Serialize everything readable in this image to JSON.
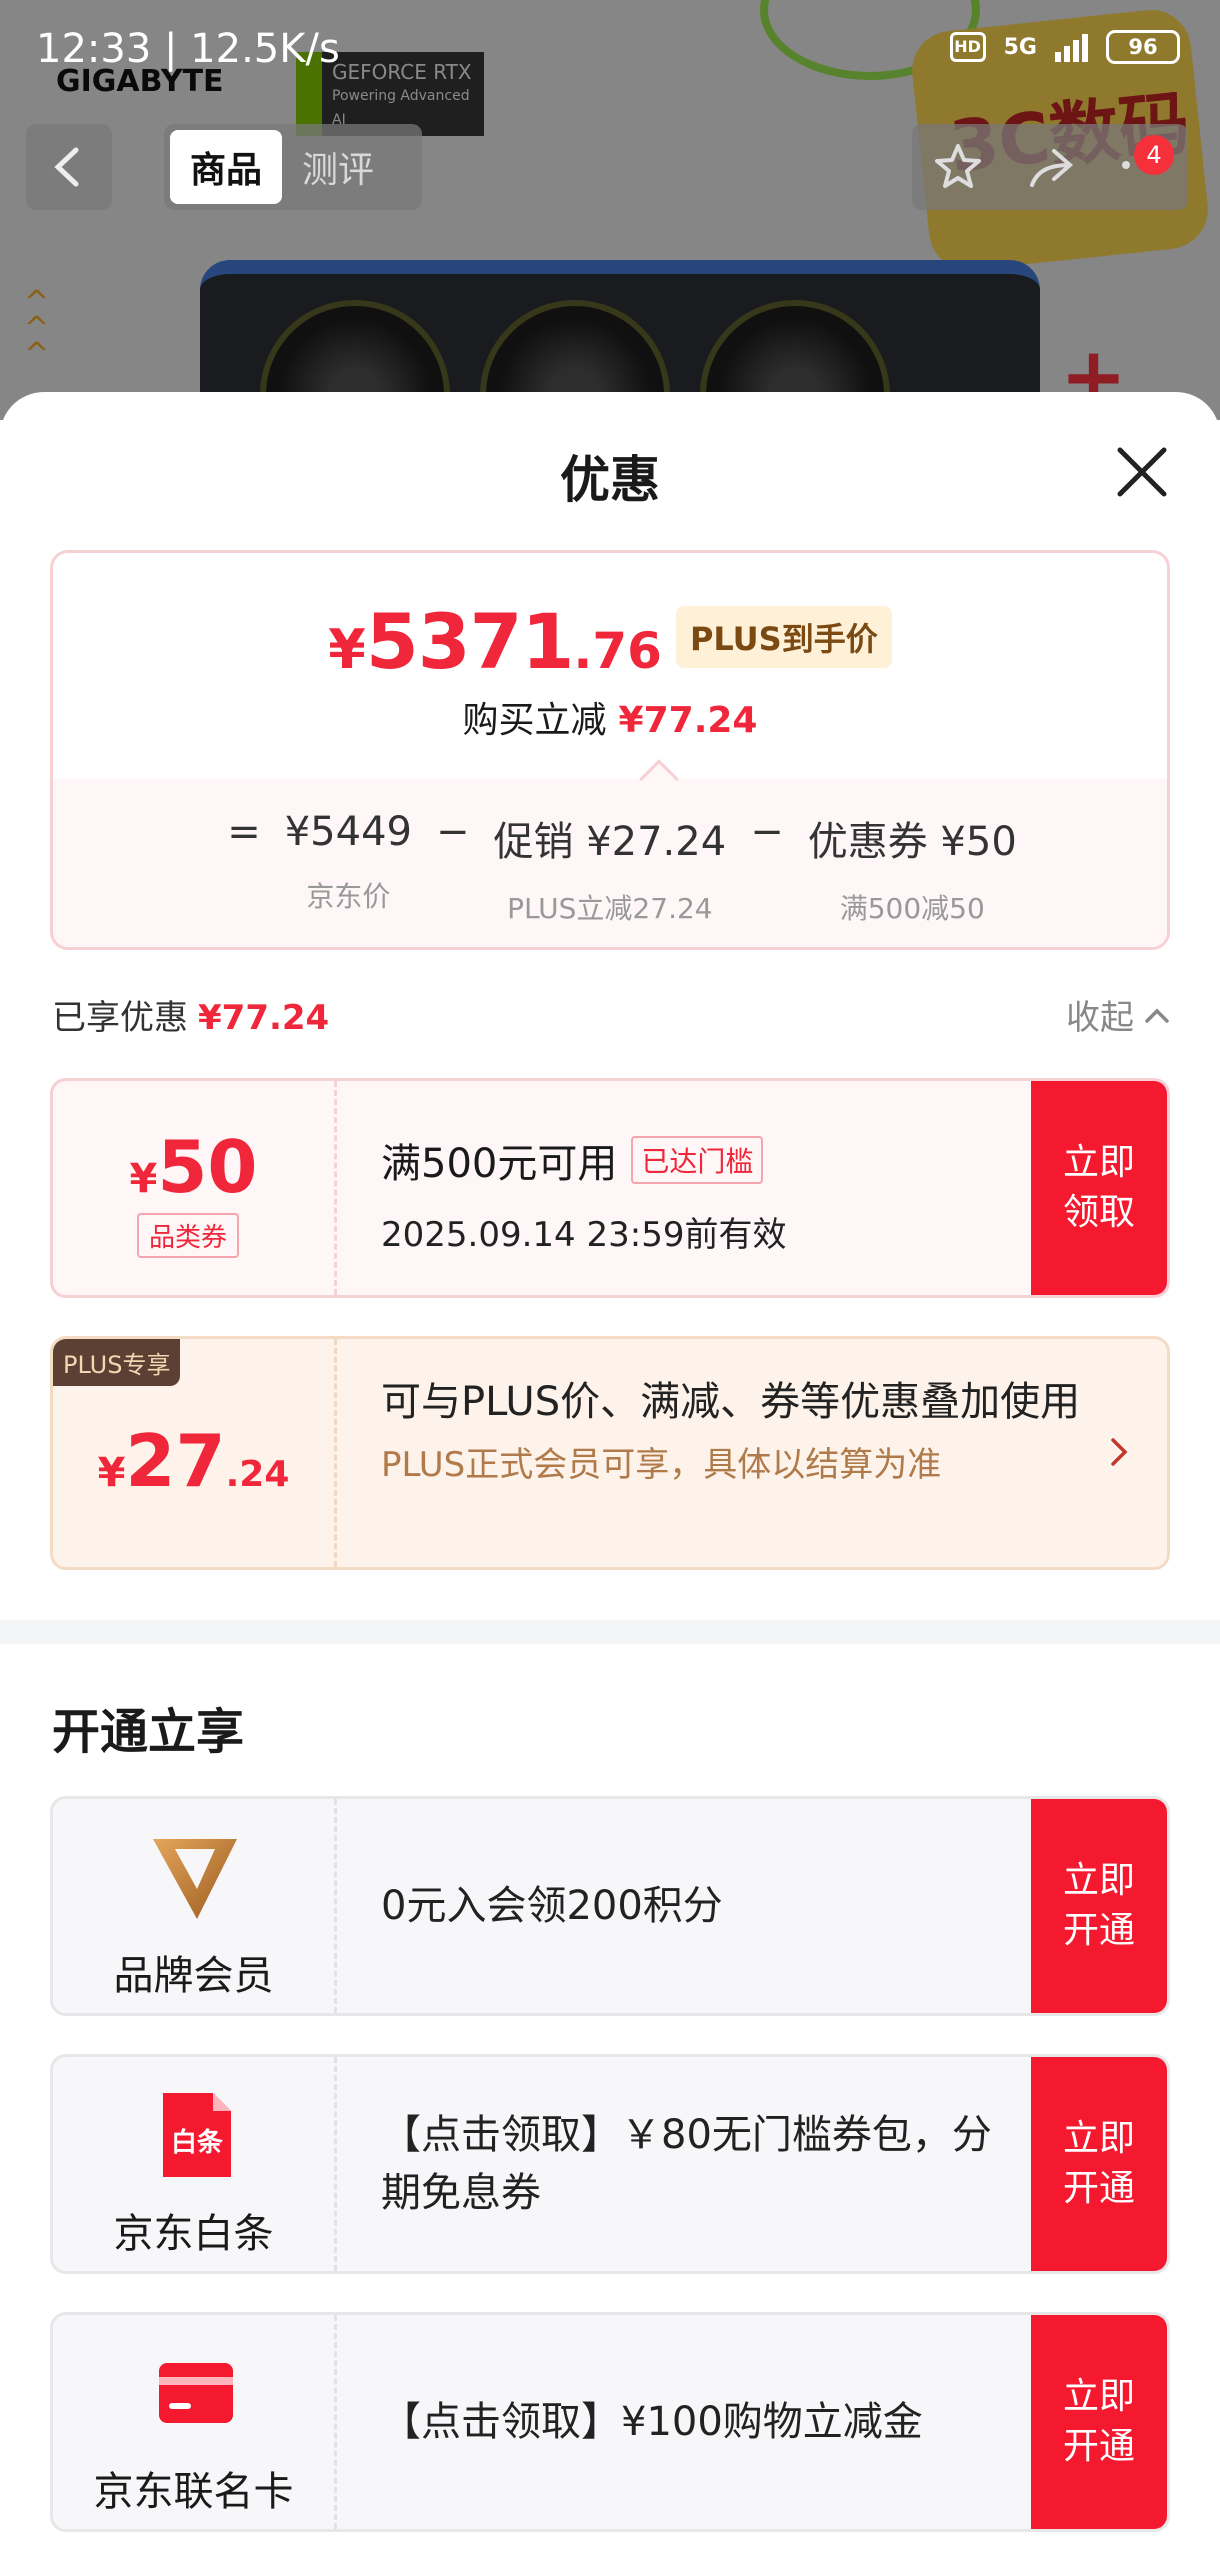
{
  "status_bar": {
    "time": "12:33 | 12.5K/s",
    "hd": "HD",
    "network": "5G",
    "battery": "96"
  },
  "header": {
    "brand_logo": "GIGABYTE",
    "nvidia_badge": "GEFORCE RTX",
    "nvidia_tagline": "Powering Advanced AI",
    "promo_sticker": "3C数码",
    "tabs": [
      "商品",
      "测评"
    ],
    "cart_badge": "4"
  },
  "sheet": {
    "title": "优惠",
    "price": {
      "yen": "¥",
      "integer": "5371",
      "decimal": ".76",
      "plus_tag": "PLUS到手价",
      "reduce_label": "购买立减",
      "reduce_value": "¥77.24"
    },
    "formula": {
      "equals": "=",
      "minus": "−",
      "items": [
        {
          "value": "¥5449",
          "label": "京东价"
        },
        {
          "value": "促销 ¥27.24",
          "label": "PLUS立减27.24"
        },
        {
          "value": "优惠券 ¥50",
          "label": "满500减50"
        }
      ]
    },
    "enjoyed": {
      "label": "已享优惠",
      "value": "¥77.24",
      "collapse": "收起"
    },
    "coupon": {
      "yen": "¥",
      "amount": "50",
      "type": "品类券",
      "condition": "满500元可用",
      "reached": "已达门槛",
      "valid": "2025.09.14 23:59前有效",
      "button": "立即领取"
    },
    "plus": {
      "tag": "PLUS专享",
      "yen": "¥",
      "amount_int": "27",
      "amount_dec": ".24",
      "desc": "可与PLUS价、满减、券等优惠叠加使用",
      "sub": "PLUS正式会员可享，具体以结算为准"
    },
    "open_title": "开通立享",
    "members": [
      {
        "name": "品牌会员",
        "icon": "brand-v-icon",
        "text": "0元入会领200积分",
        "button": "立即开通"
      },
      {
        "name": "京东白条",
        "icon": "baitiao-icon",
        "icon_text": "白条",
        "text": "【点击领取】￥80无门槛券包，分期免息券",
        "button": "立即开通"
      },
      {
        "name": "京东联名卡",
        "icon": "card-icon",
        "text": "【点击领取】¥100购物立减金",
        "button": "立即开通"
      }
    ]
  },
  "colors": {
    "accent_red": "#f5192f",
    "price_red": "#f0263a",
    "plus_brown": "#5c4033"
  }
}
